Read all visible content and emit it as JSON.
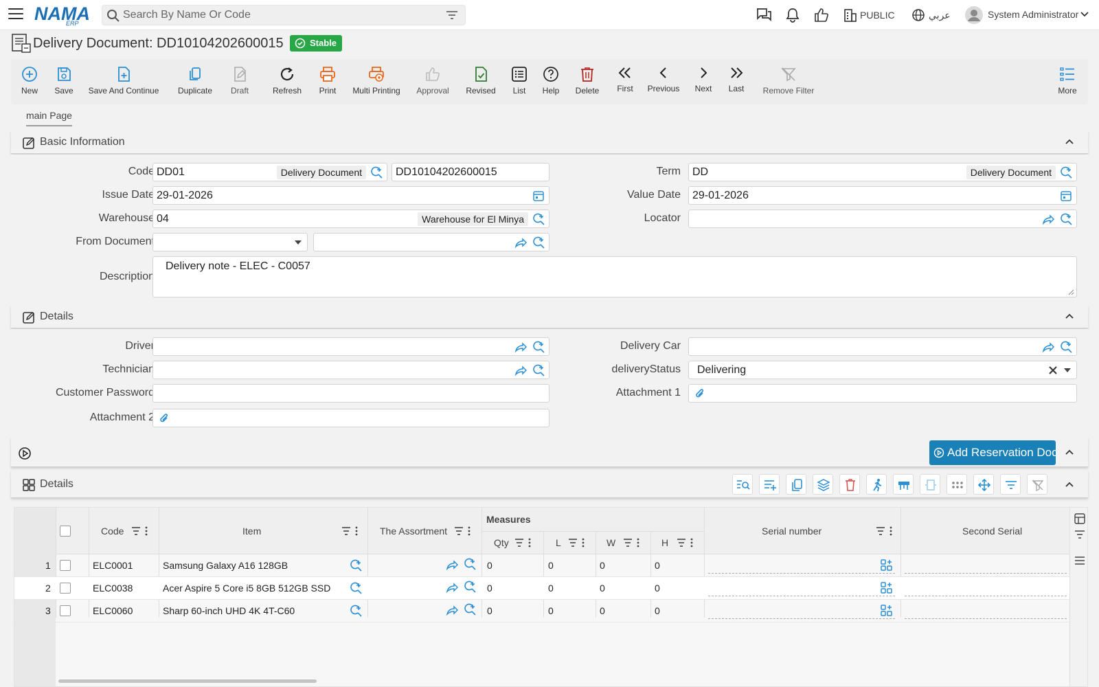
{
  "header": {
    "logo_text": "NAMA",
    "logo_sub": "ERP",
    "search_placeholder": "Search By Name Or Code",
    "public_label": "PUBLIC",
    "language_label": "عربي",
    "user_name": "System Administrator"
  },
  "page": {
    "title": "Delivery Document: DD10104202600015",
    "status_badge": "Stable"
  },
  "toolbar": {
    "new": "New",
    "save": "Save",
    "save_continue": "Save And Continue",
    "duplicate": "Duplicate",
    "draft": "Draft",
    "refresh": "Refresh",
    "print": "Print",
    "multi_printing": "Multi Printing",
    "approval": "Approval",
    "revised": "Revised",
    "list": "List",
    "help": "Help",
    "delete": "Delete",
    "first": "First",
    "previous": "Previous",
    "next": "Next",
    "last": "Last",
    "remove_filter": "Remove Filter",
    "more": "More"
  },
  "tabs": {
    "main": "main Page"
  },
  "basic_info": {
    "title": "Basic Information",
    "code_label": "Code",
    "code_value": "DD01",
    "code_tag": "Delivery Document",
    "code_number": "DD10104202600015",
    "term_label": "Term",
    "term_value": "DD",
    "term_tag": "Delivery Document",
    "issue_date_label": "Issue Date",
    "issue_date_value": "29-01-2026",
    "value_date_label": "Value Date",
    "value_date_value": "29-01-2026",
    "warehouse_label": "Warehouse",
    "warehouse_value": "04",
    "warehouse_tag": "Warehouse for El Minya",
    "locator_label": "Locator",
    "from_document_label": "From Document",
    "description_label": "Description",
    "description_value": "Delivery note - ELEC - C0057"
  },
  "details": {
    "title": "Details",
    "driver_label": "Driver",
    "delivery_car_label": "Delivery Car",
    "technician_label": "Technician",
    "delivery_status_label": "deliveryStatus",
    "delivery_status_value": "Delivering",
    "customer_password_label": "Customer Password",
    "attachment1_label": "Attachment 1",
    "attachment2_label": "Attachment 2"
  },
  "actions": {
    "add_reservation": "Add Reservation Doc"
  },
  "grid": {
    "title": "Details",
    "headers": {
      "code": "Code",
      "item": "Item",
      "assortment": "The Assortment",
      "measures": "Measures",
      "qty": "Qty",
      "l": "L",
      "w": "W",
      "h": "H",
      "serial": "Serial number",
      "second_serial": "Second Serial"
    },
    "rows": [
      {
        "num": "1",
        "code": "ELC0001",
        "item": "Samsung Galaxy A16 128GB",
        "qty": "0",
        "l": "0",
        "w": "0",
        "h": "0"
      },
      {
        "num": "2",
        "code": "ELC0038",
        "item": "Acer Aspire 5 Core i5 8GB 512GB SSD",
        "qty": "0",
        "l": "0",
        "w": "0",
        "h": "0"
      },
      {
        "num": "3",
        "code": "ELC0060",
        "item": "Sharp 60-inch UHD 4K 4T-C60",
        "qty": "0",
        "l": "0",
        "w": "0",
        "h": "0"
      }
    ]
  },
  "colors": {
    "accent": "#1a80b8",
    "stable": "#27a745",
    "print": "#e8691b",
    "delete": "#b3261e",
    "revised": "#2e7d32",
    "icon_blue": "#2b8fd6"
  }
}
